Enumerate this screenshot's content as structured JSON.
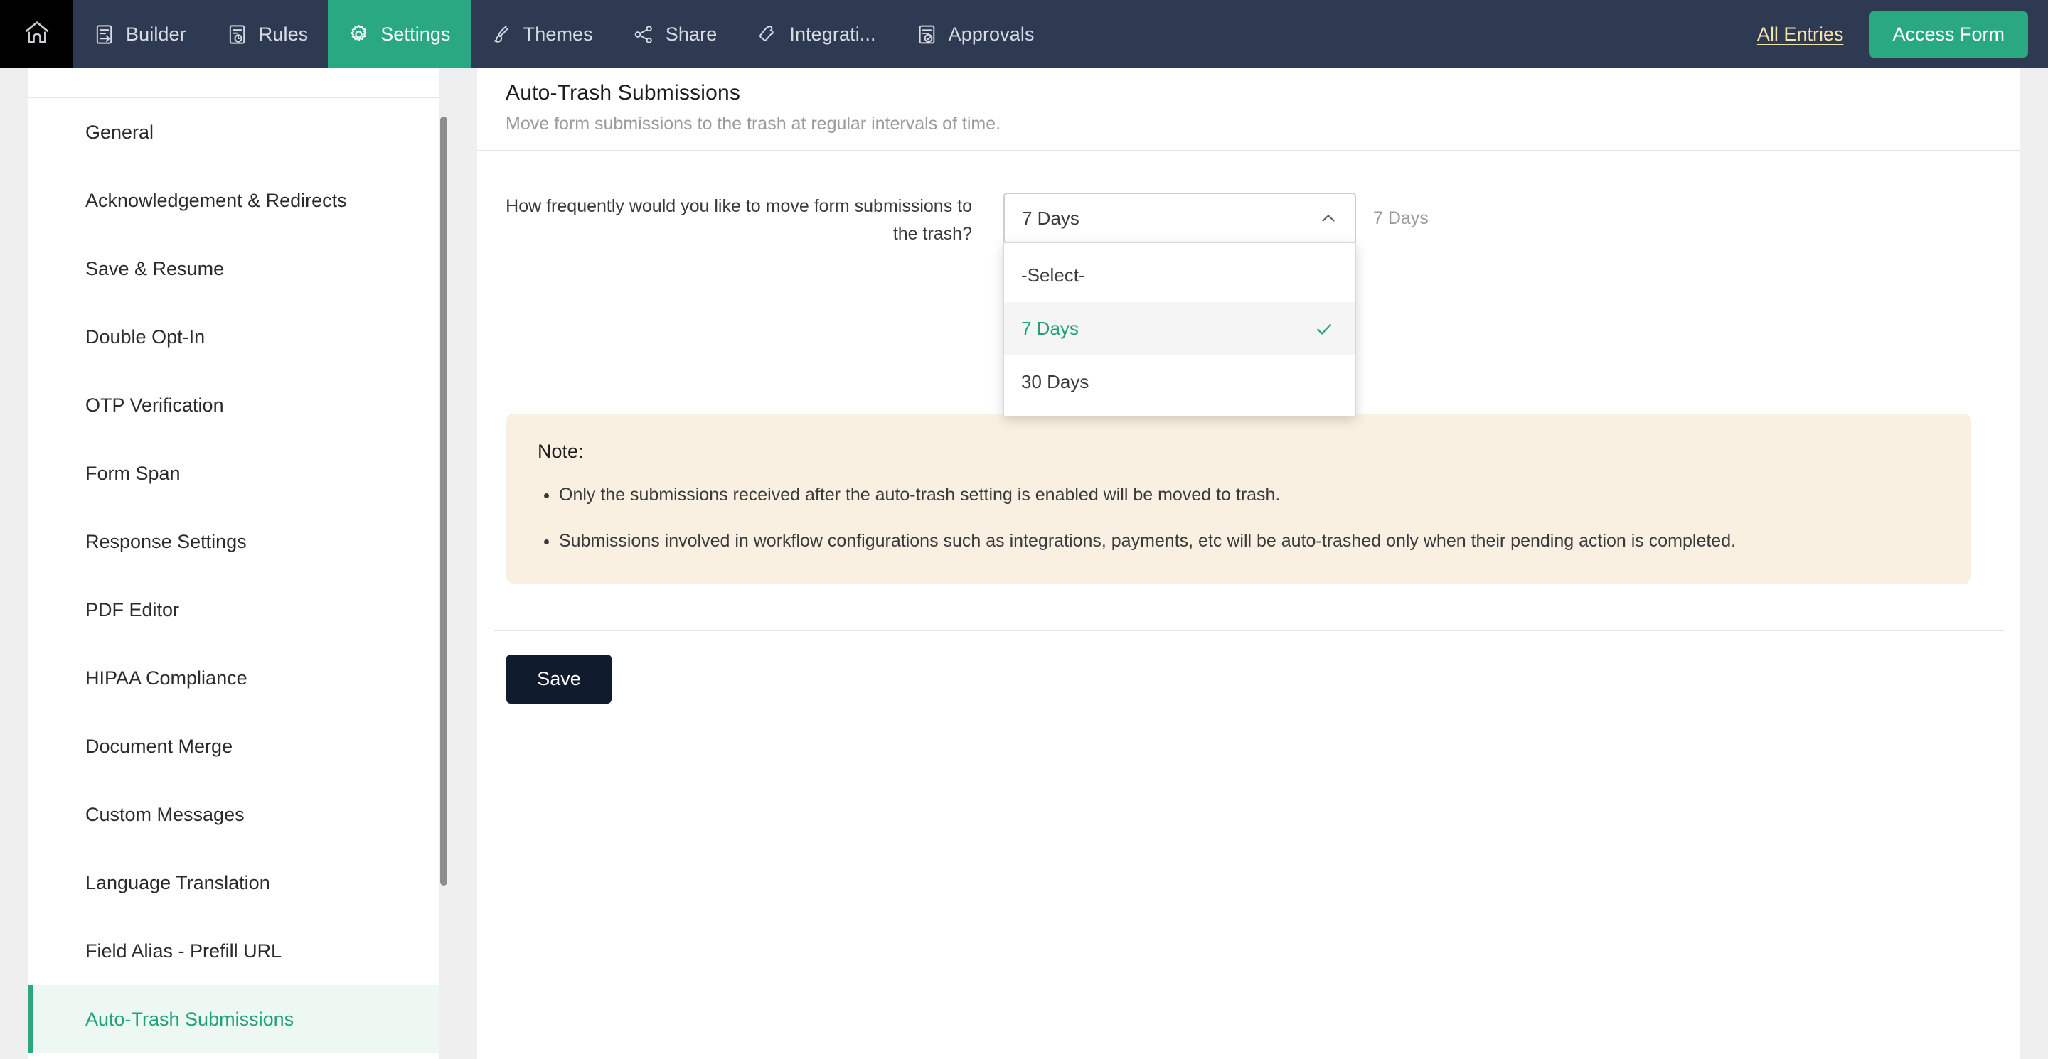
{
  "topnav": {
    "home_icon": "home-icon",
    "items": [
      {
        "label": "Builder",
        "icon": "builder-icon",
        "active": false
      },
      {
        "label": "Rules",
        "icon": "rules-icon",
        "active": false
      },
      {
        "label": "Settings",
        "icon": "gear-icon",
        "active": true
      },
      {
        "label": "Themes",
        "icon": "brush-icon",
        "active": false
      },
      {
        "label": "Share",
        "icon": "share-icon",
        "active": false
      },
      {
        "label": "Integrati...",
        "icon": "integrations-icon",
        "active": false
      },
      {
        "label": "Approvals",
        "icon": "approvals-icon",
        "active": false
      }
    ],
    "all_entries_label": "All Entries",
    "access_form_label": "Access Form",
    "colors": {
      "nav_bg": "#2e3a52",
      "home_bg": "#000000",
      "active_tab_bg": "#2aa881",
      "link": "#f5e3ae",
      "button_bg": "#2aa881"
    }
  },
  "sidebar": {
    "items": [
      {
        "label": "General",
        "active": false
      },
      {
        "label": "Acknowledgement & Redirects",
        "active": false
      },
      {
        "label": "Save & Resume",
        "active": false
      },
      {
        "label": "Double Opt-In",
        "active": false
      },
      {
        "label": "OTP Verification",
        "active": false
      },
      {
        "label": "Form Span",
        "active": false
      },
      {
        "label": "Response Settings",
        "active": false
      },
      {
        "label": "PDF Editor",
        "active": false
      },
      {
        "label": "HIPAA Compliance",
        "active": false
      },
      {
        "label": "Document Merge",
        "active": false
      },
      {
        "label": "Custom Messages",
        "active": false
      },
      {
        "label": "Language Translation",
        "active": false
      },
      {
        "label": "Field Alias - Prefill URL",
        "active": false
      },
      {
        "label": "Auto-Trash Submissions",
        "active": true
      }
    ],
    "active_colors": {
      "bg": "#edf8f3",
      "text": "#22a179",
      "bar": "#2aa881"
    }
  },
  "main": {
    "title": "Auto-Trash Submissions",
    "subtitle": "Move form submissions to the trash at regular intervals of time.",
    "field": {
      "label": "How frequently would you like to move form submissions to the trash?",
      "selected_value": "7 Days",
      "helper_text": "7 Days",
      "dropdown_open": true,
      "options": [
        {
          "label": "-Select-",
          "selected": false
        },
        {
          "label": "7 Days",
          "selected": true
        },
        {
          "label": "30 Days",
          "selected": false
        }
      ]
    },
    "note": {
      "title": "Note:",
      "bullets": [
        "Only the submissions received after the auto-trash setting is enabled will be moved to trash.",
        "Submissions involved in workflow configurations such as integrations, payments, etc will be auto-trashed only when their pending action is completed."
      ],
      "bg_color": "#faf0e2"
    },
    "save_label": "Save",
    "save_bg": "#101c2d"
  }
}
